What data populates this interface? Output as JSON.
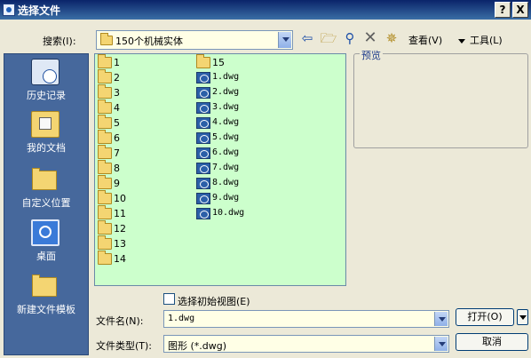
{
  "window": {
    "title": "选择文件",
    "help_label": "?",
    "close_label": "X"
  },
  "toolbar": {
    "search_label": "搜索(I):",
    "location": "150个机械实体",
    "views_label": "查看(V)",
    "tools_label": "工具(L)",
    "back_icon": "arrow-left-icon",
    "up_icon": "folder-up-icon",
    "search_web_icon": "magnifier-icon",
    "delete_icon": "delete-x-icon",
    "new_folder_icon": "new-folder-icon"
  },
  "places": [
    {
      "label": "历史记录",
      "icon": "history-icon"
    },
    {
      "label": "我的文档",
      "icon": "my-documents-icon"
    },
    {
      "label": "自定义位置",
      "icon": "folder-icon"
    },
    {
      "label": "桌面",
      "icon": "desktop-icon"
    },
    {
      "label": "新建文件模板",
      "icon": "folder-icon"
    }
  ],
  "files_col1": [
    "1",
    "2",
    "3",
    "4",
    "5",
    "6",
    "7",
    "8",
    "9",
    "10",
    "11",
    "12",
    "13",
    "14"
  ],
  "files_col2": [
    {
      "name": "15",
      "type": "folder"
    },
    {
      "name": "1.dwg",
      "type": "dwg"
    },
    {
      "name": "2.dwg",
      "type": "dwg"
    },
    {
      "name": "3.dwg",
      "type": "dwg"
    },
    {
      "name": "4.dwg",
      "type": "dwg"
    },
    {
      "name": "5.dwg",
      "type": "dwg"
    },
    {
      "name": "6.dwg",
      "type": "dwg"
    },
    {
      "name": "7.dwg",
      "type": "dwg"
    },
    {
      "name": "8.dwg",
      "type": "dwg"
    },
    {
      "name": "9.dwg",
      "type": "dwg"
    },
    {
      "name": "10.dwg",
      "type": "dwg"
    }
  ],
  "preview_label": "预览",
  "initial_view_label": "选择初始视图(E)",
  "filename": {
    "label": "文件名(N):",
    "value": "1.dwg"
  },
  "filetype": {
    "label": "文件类型(T):",
    "value": "图形 (*.dwg)"
  },
  "buttons": {
    "open": "打开(O)",
    "cancel": "取消"
  },
  "colors": {
    "file_list_bg": "#ccffcc",
    "combo_bg": "#ffffe6",
    "places_bg": "#46689c",
    "titlebar": "#0a246a"
  }
}
